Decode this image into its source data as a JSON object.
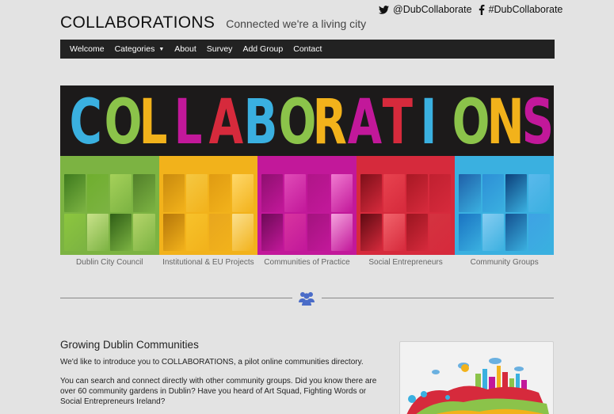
{
  "social": {
    "twitter_handle": "@DubCollaborate",
    "facebook_tag": "#DubCollaborate"
  },
  "header": {
    "title": "COLLABORATIONS",
    "tagline": "Connected we're a living city"
  },
  "nav": {
    "items": [
      "Welcome",
      "Categories",
      "About",
      "Survey",
      "Add Group",
      "Contact"
    ]
  },
  "banner": {
    "word": "COLLABORATIONS",
    "letters": [
      {
        "char": "C",
        "color": "#3ab0e0"
      },
      {
        "char": "O",
        "color": "#8bc34a"
      },
      {
        "char": "L",
        "color": "#f2b21b"
      },
      {
        "char": "L",
        "color": "#c2189a"
      },
      {
        "char": "A",
        "color": "#d62a3c"
      },
      {
        "char": "B",
        "color": "#3ab0e0"
      },
      {
        "char": "O",
        "color": "#8bc34a"
      },
      {
        "char": "R",
        "color": "#f2b21b"
      },
      {
        "char": "A",
        "color": "#c2189a"
      },
      {
        "char": "T",
        "color": "#d62a3c"
      },
      {
        "char": "I",
        "color": "#3ab0e0"
      },
      {
        "char": "O",
        "color": "#8bc34a"
      },
      {
        "char": "N",
        "color": "#f2b21b"
      },
      {
        "char": "S",
        "color": "#c2189a"
      }
    ],
    "panels": [
      {
        "caption": "Dublin City Council",
        "color": "#7cb342",
        "tiles": [
          "#3e7a1e",
          "#6fae2e",
          "#a5d15a",
          "#517f2a",
          "#8cc63e",
          "#c9e28a",
          "#2f5e16",
          "#b5d56b"
        ]
      },
      {
        "caption": "Institutional & EU Projects",
        "color": "#f2b21b",
        "tiles": [
          "#c98a0e",
          "#f5c842",
          "#e09b12",
          "#ffd86a",
          "#b5760a",
          "#f7c22b",
          "#e8a61e",
          "#fbe08f"
        ]
      },
      {
        "caption": "Communities of Practice",
        "color": "#c2189a",
        "tiles": [
          "#8e0f6f",
          "#e04bb7",
          "#b01588",
          "#f07ad0",
          "#6d0a56",
          "#d8349f",
          "#a3137e",
          "#f5a3de"
        ]
      },
      {
        "caption": "Social Entrepreneurs",
        "color": "#d62a3c",
        "tiles": [
          "#7d0f19",
          "#e8434f",
          "#a81824",
          "#c02030",
          "#5e0a12",
          "#f2646c",
          "#9a1520",
          "#d43340"
        ]
      },
      {
        "caption": "Community Groups",
        "color": "#3ab0e0",
        "tiles": [
          "#1f5fa8",
          "#2d8fd6",
          "#0c3f7a",
          "#5ab9ec",
          "#1a73c2",
          "#87cdf2",
          "#14508f",
          "#3ea2e4"
        ]
      }
    ]
  },
  "intro": {
    "heading": "Growing Dublin Communities",
    "paragraphs": [
      "We'd like to introduce you to COLLABORATIONS, a pilot online communities directory.",
      "You can search and connect directly with other community groups. Did you know there are over 60 community gardens in Dublin? Have you heard of Art Squad, Fighting Words or Social Entrepreneurs Ireland?"
    ]
  },
  "colors": {
    "navbar_bg": "#222222",
    "page_bg": "#e3e3e3",
    "icon_blue": "#4a6cc8"
  }
}
